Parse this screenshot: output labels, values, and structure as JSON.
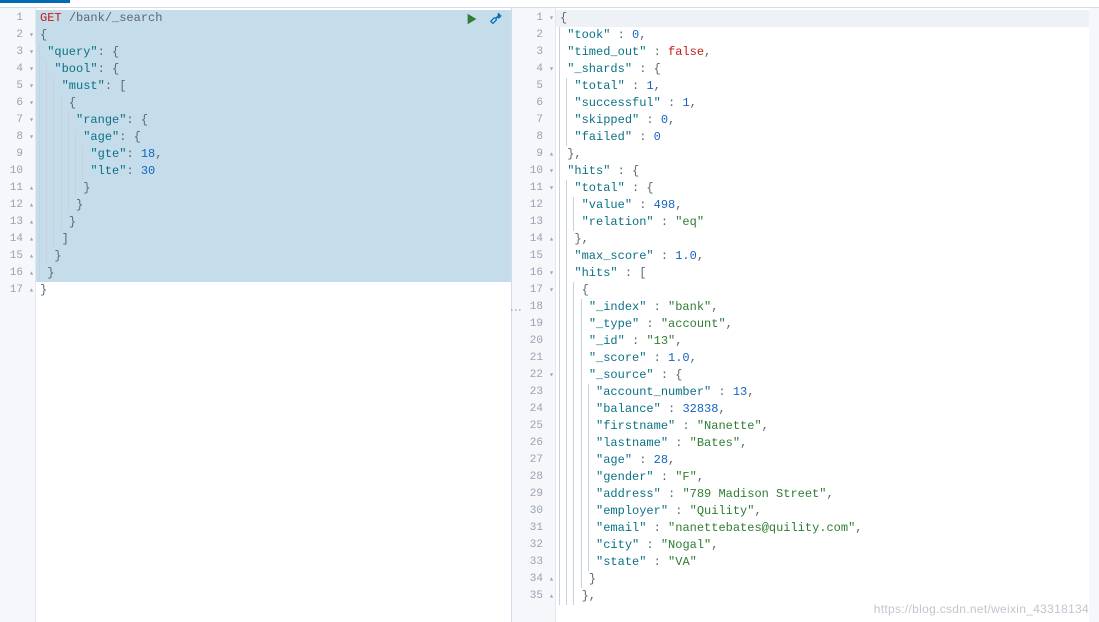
{
  "request": {
    "method": "GET",
    "path": "/bank/_search",
    "lines": [
      {
        "n": 1,
        "fold": "",
        "selected": true
      },
      {
        "n": 2,
        "fold": "▾",
        "selected": true
      },
      {
        "n": 3,
        "fold": "▾",
        "selected": true
      },
      {
        "n": 4,
        "fold": "▾",
        "selected": true
      },
      {
        "n": 5,
        "fold": "▾",
        "selected": true
      },
      {
        "n": 6,
        "fold": "▾",
        "selected": true
      },
      {
        "n": 7,
        "fold": "▾",
        "selected": true
      },
      {
        "n": 8,
        "fold": "▾",
        "selected": true
      },
      {
        "n": 9,
        "fold": "",
        "selected": true
      },
      {
        "n": 10,
        "fold": "",
        "selected": true
      },
      {
        "n": 11,
        "fold": "▴",
        "selected": true
      },
      {
        "n": 12,
        "fold": "▴",
        "selected": true
      },
      {
        "n": 13,
        "fold": "▴",
        "selected": true
      },
      {
        "n": 14,
        "fold": "▴",
        "selected": true
      },
      {
        "n": 15,
        "fold": "▴",
        "selected": true
      },
      {
        "n": 16,
        "fold": "▴",
        "selected": true
      },
      {
        "n": 17,
        "fold": "▴",
        "selected": false
      }
    ],
    "body": {
      "query": {
        "bool": {
          "must": [
            {
              "range": {
                "age": {
                  "gte": 18,
                  "lte": 30
                }
              }
            }
          ]
        }
      }
    }
  },
  "response": {
    "lines_count": 35,
    "folds": {
      "1": "▾",
      "4": "▾",
      "9": "▴",
      "10": "▾",
      "11": "▾",
      "14": "▴",
      "16": "▾",
      "17": "▾",
      "22": "▾",
      "34": "▴",
      "35": "▴"
    },
    "body": {
      "took": 0,
      "timed_out": false,
      "_shards": {
        "total": 1,
        "successful": 1,
        "skipped": 0,
        "failed": 0
      },
      "hits": {
        "total": {
          "value": 498,
          "relation": "eq"
        },
        "max_score": 1.0,
        "hits": [
          {
            "_index": "bank",
            "_type": "account",
            "_id": "13",
            "_score": 1.0,
            "_source": {
              "account_number": 13,
              "balance": 32838,
              "firstname": "Nanette",
              "lastname": "Bates",
              "age": 28,
              "gender": "F",
              "address": "789 Madison Street",
              "employer": "Quility",
              "email": "nanettebates@quility.com",
              "city": "Nogal",
              "state": "VA"
            }
          }
        ]
      }
    }
  },
  "watermark": "https://blog.csdn.net/weixin_43318134"
}
